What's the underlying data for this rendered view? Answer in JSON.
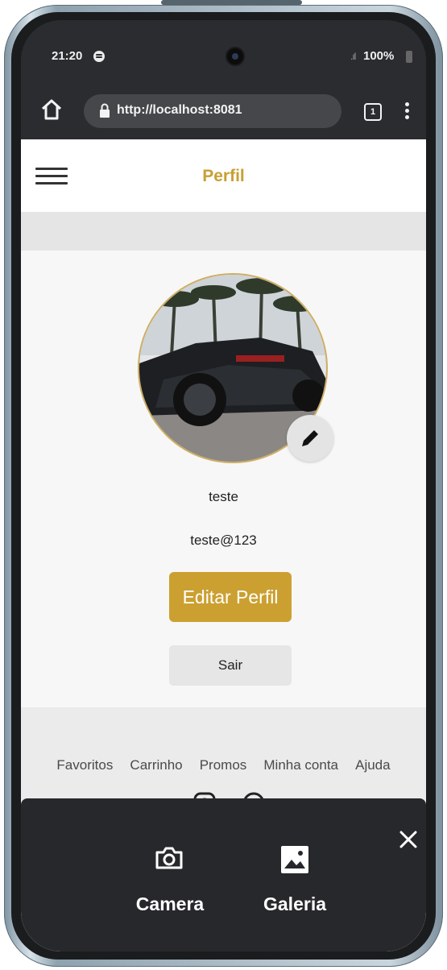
{
  "status_bar": {
    "time": "21:20",
    "signal": ".ıl",
    "battery": "100%"
  },
  "browser": {
    "url": "http://localhost:8081",
    "tab_count": "1"
  },
  "header": {
    "title": "Perfil"
  },
  "profile": {
    "name": "teste",
    "email": "teste@123",
    "edit_button": "Editar Perfil",
    "logout_button": "Sair"
  },
  "footer": {
    "links": [
      "Favoritos",
      "Carrinho",
      "Promos",
      "Minha conta",
      "Ajuda"
    ]
  },
  "sheet": {
    "camera_label": "Camera",
    "gallery_label": "Galeria"
  },
  "colors": {
    "accent": "#cba031",
    "browser_bar": "#2b2c2f",
    "sheet": "#27282b"
  },
  "icons": [
    "home-icon",
    "lock-icon",
    "tabs-icon",
    "more-icon",
    "hamburger-icon",
    "pencil-icon",
    "instagram-icon",
    "whatsapp-icon",
    "camera-icon",
    "gallery-icon",
    "close-icon"
  ]
}
